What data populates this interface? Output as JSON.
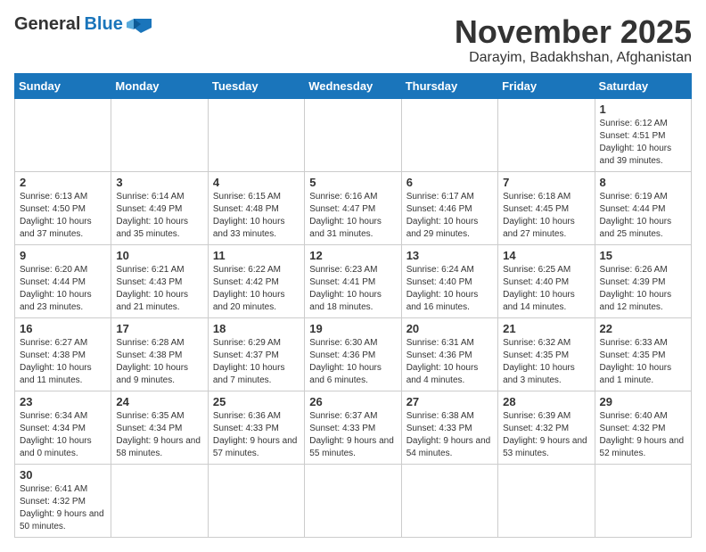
{
  "header": {
    "logo_general": "General",
    "logo_blue": "Blue",
    "month_title": "November 2025",
    "location": "Darayim, Badakhshan, Afghanistan"
  },
  "weekdays": [
    "Sunday",
    "Monday",
    "Tuesday",
    "Wednesday",
    "Thursday",
    "Friday",
    "Saturday"
  ],
  "weeks": [
    [
      {
        "day": "",
        "info": ""
      },
      {
        "day": "",
        "info": ""
      },
      {
        "day": "",
        "info": ""
      },
      {
        "day": "",
        "info": ""
      },
      {
        "day": "",
        "info": ""
      },
      {
        "day": "",
        "info": ""
      },
      {
        "day": "1",
        "info": "Sunrise: 6:12 AM\nSunset: 4:51 PM\nDaylight: 10 hours and 39 minutes."
      }
    ],
    [
      {
        "day": "2",
        "info": "Sunrise: 6:13 AM\nSunset: 4:50 PM\nDaylight: 10 hours and 37 minutes."
      },
      {
        "day": "3",
        "info": "Sunrise: 6:14 AM\nSunset: 4:49 PM\nDaylight: 10 hours and 35 minutes."
      },
      {
        "day": "4",
        "info": "Sunrise: 6:15 AM\nSunset: 4:48 PM\nDaylight: 10 hours and 33 minutes."
      },
      {
        "day": "5",
        "info": "Sunrise: 6:16 AM\nSunset: 4:47 PM\nDaylight: 10 hours and 31 minutes."
      },
      {
        "day": "6",
        "info": "Sunrise: 6:17 AM\nSunset: 4:46 PM\nDaylight: 10 hours and 29 minutes."
      },
      {
        "day": "7",
        "info": "Sunrise: 6:18 AM\nSunset: 4:45 PM\nDaylight: 10 hours and 27 minutes."
      },
      {
        "day": "8",
        "info": "Sunrise: 6:19 AM\nSunset: 4:44 PM\nDaylight: 10 hours and 25 minutes."
      }
    ],
    [
      {
        "day": "9",
        "info": "Sunrise: 6:20 AM\nSunset: 4:44 PM\nDaylight: 10 hours and 23 minutes."
      },
      {
        "day": "10",
        "info": "Sunrise: 6:21 AM\nSunset: 4:43 PM\nDaylight: 10 hours and 21 minutes."
      },
      {
        "day": "11",
        "info": "Sunrise: 6:22 AM\nSunset: 4:42 PM\nDaylight: 10 hours and 20 minutes."
      },
      {
        "day": "12",
        "info": "Sunrise: 6:23 AM\nSunset: 4:41 PM\nDaylight: 10 hours and 18 minutes."
      },
      {
        "day": "13",
        "info": "Sunrise: 6:24 AM\nSunset: 4:40 PM\nDaylight: 10 hours and 16 minutes."
      },
      {
        "day": "14",
        "info": "Sunrise: 6:25 AM\nSunset: 4:40 PM\nDaylight: 10 hours and 14 minutes."
      },
      {
        "day": "15",
        "info": "Sunrise: 6:26 AM\nSunset: 4:39 PM\nDaylight: 10 hours and 12 minutes."
      }
    ],
    [
      {
        "day": "16",
        "info": "Sunrise: 6:27 AM\nSunset: 4:38 PM\nDaylight: 10 hours and 11 minutes."
      },
      {
        "day": "17",
        "info": "Sunrise: 6:28 AM\nSunset: 4:38 PM\nDaylight: 10 hours and 9 minutes."
      },
      {
        "day": "18",
        "info": "Sunrise: 6:29 AM\nSunset: 4:37 PM\nDaylight: 10 hours and 7 minutes."
      },
      {
        "day": "19",
        "info": "Sunrise: 6:30 AM\nSunset: 4:36 PM\nDaylight: 10 hours and 6 minutes."
      },
      {
        "day": "20",
        "info": "Sunrise: 6:31 AM\nSunset: 4:36 PM\nDaylight: 10 hours and 4 minutes."
      },
      {
        "day": "21",
        "info": "Sunrise: 6:32 AM\nSunset: 4:35 PM\nDaylight: 10 hours and 3 minutes."
      },
      {
        "day": "22",
        "info": "Sunrise: 6:33 AM\nSunset: 4:35 PM\nDaylight: 10 hours and 1 minute."
      }
    ],
    [
      {
        "day": "23",
        "info": "Sunrise: 6:34 AM\nSunset: 4:34 PM\nDaylight: 10 hours and 0 minutes."
      },
      {
        "day": "24",
        "info": "Sunrise: 6:35 AM\nSunset: 4:34 PM\nDaylight: 9 hours and 58 minutes."
      },
      {
        "day": "25",
        "info": "Sunrise: 6:36 AM\nSunset: 4:33 PM\nDaylight: 9 hours and 57 minutes."
      },
      {
        "day": "26",
        "info": "Sunrise: 6:37 AM\nSunset: 4:33 PM\nDaylight: 9 hours and 55 minutes."
      },
      {
        "day": "27",
        "info": "Sunrise: 6:38 AM\nSunset: 4:33 PM\nDaylight: 9 hours and 54 minutes."
      },
      {
        "day": "28",
        "info": "Sunrise: 6:39 AM\nSunset: 4:32 PM\nDaylight: 9 hours and 53 minutes."
      },
      {
        "day": "29",
        "info": "Sunrise: 6:40 AM\nSunset: 4:32 PM\nDaylight: 9 hours and 52 minutes."
      }
    ],
    [
      {
        "day": "30",
        "info": "Sunrise: 6:41 AM\nSunset: 4:32 PM\nDaylight: 9 hours and 50 minutes."
      },
      {
        "day": "",
        "info": ""
      },
      {
        "day": "",
        "info": ""
      },
      {
        "day": "",
        "info": ""
      },
      {
        "day": "",
        "info": ""
      },
      {
        "day": "",
        "info": ""
      },
      {
        "day": "",
        "info": ""
      }
    ]
  ]
}
